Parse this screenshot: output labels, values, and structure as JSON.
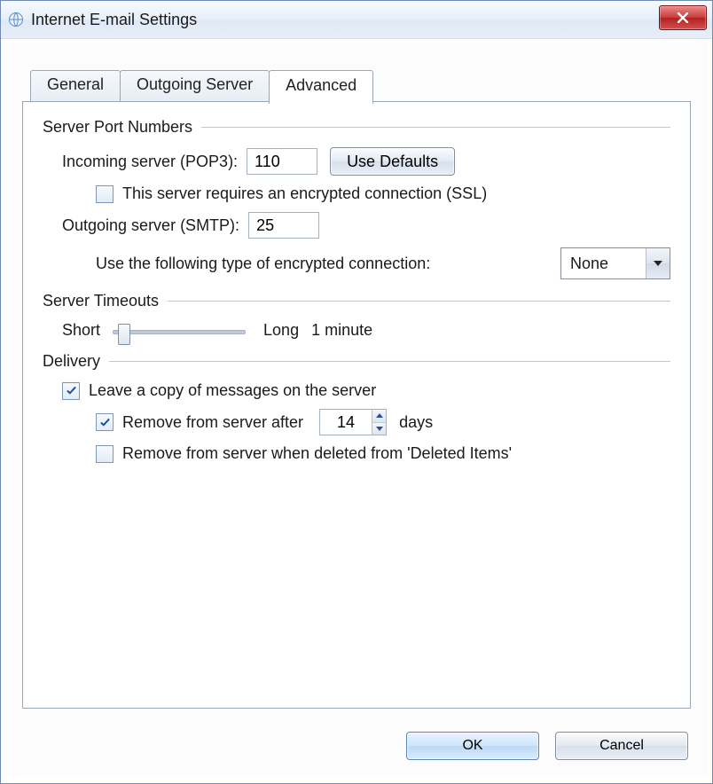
{
  "window": {
    "title": "Internet E-mail Settings"
  },
  "tabs": {
    "general": "General",
    "outgoing": "Outgoing Server",
    "advanced": "Advanced"
  },
  "groups": {
    "ports": {
      "title": "Server Port Numbers",
      "incoming_label": "Incoming server (POP3):",
      "incoming_value": "110",
      "use_defaults": "Use Defaults",
      "ssl_label": "This server requires an encrypted connection (SSL)",
      "ssl_checked": false,
      "outgoing_label": "Outgoing server (SMTP):",
      "outgoing_value": "25",
      "enc_label": "Use the following type of encrypted connection:",
      "enc_value": "None"
    },
    "timeouts": {
      "title": "Server Timeouts",
      "short": "Short",
      "long": "Long",
      "value": "1 minute"
    },
    "delivery": {
      "title": "Delivery",
      "leave_copy": "Leave a copy of messages on the server",
      "leave_copy_checked": true,
      "remove_after": "Remove from server after",
      "remove_after_checked": true,
      "remove_days": "14",
      "days_label": "days",
      "remove_deleted": "Remove from server when deleted from 'Deleted Items'",
      "remove_deleted_checked": false
    }
  },
  "footer": {
    "ok": "OK",
    "cancel": "Cancel"
  }
}
